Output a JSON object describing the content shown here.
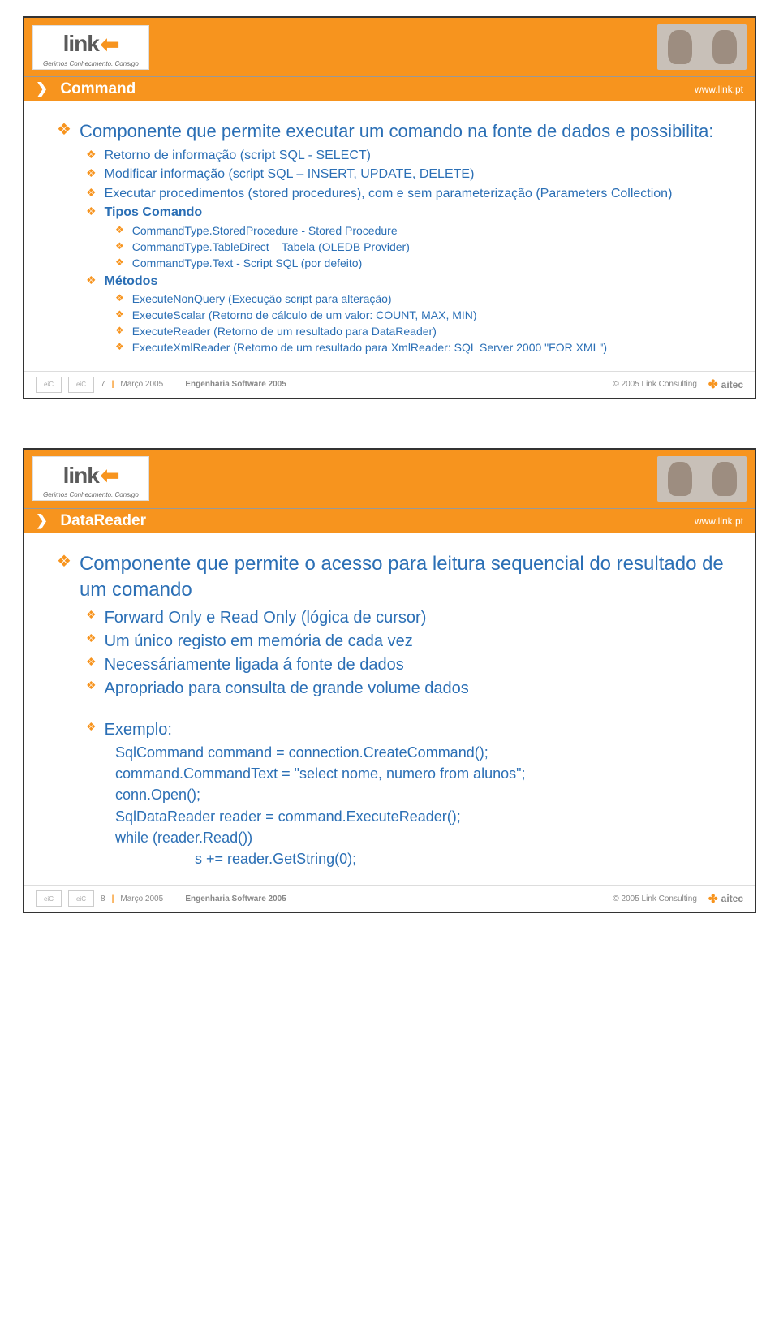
{
  "brand": {
    "logo_text": "link",
    "tagline": "Gerimos Conhecimento. Consigo"
  },
  "footer": {
    "date": "Março 2005",
    "course": "Engenharia Software 2005",
    "copyright": "© 2005 Link Consulting",
    "badge": "eiC",
    "partner": "aitec"
  },
  "slide1": {
    "page": "7",
    "title": "Command",
    "url": "www.link.pt",
    "h1": "Componente que permite executar um comando na fonte de dados e possibilita:",
    "items1": [
      "Retorno de informação (script SQL - SELECT)",
      "Modificar informação (script SQL – INSERT, UPDATE, DELETE)",
      "Executar procedimentos (stored procedures), com e sem parameterização (Parameters Collection)"
    ],
    "h2": "Tipos Comando",
    "items2": [
      "CommandType.StoredProcedure - Stored Procedure",
      "CommandType.TableDirect – Tabela (OLEDB Provider)",
      "CommandType.Text - Script SQL (por defeito)"
    ],
    "h3": "Métodos",
    "items3": [
      "ExecuteNonQuery (Execução script para alteração)",
      "ExecuteScalar (Retorno de cálculo de um valor: COUNT, MAX, MIN)",
      "ExecuteReader (Retorno de um resultado para DataReader)",
      "ExecuteXmlReader (Retorno de um resultado para XmlReader: SQL Server 2000 \"FOR XML\")"
    ]
  },
  "slide2": {
    "page": "8",
    "title": "DataReader",
    "url": "www.link.pt",
    "h1": "Componente que permite o acesso para leitura sequencial do resultado de um comando",
    "items1": [
      "Forward Only e Read Only (lógica de cursor)",
      "Um único registo em memória de cada vez",
      "Necessáriamente ligada á fonte de dados",
      "Apropriado para consulta de grande volume dados"
    ],
    "example_label": "Exemplo:",
    "code": [
      "SqlCommand command = connection.CreateCommand();",
      "command.CommandText = \"select nome, numero from alunos\";",
      "conn.Open();",
      "SqlDataReader reader = command.ExecuteReader();",
      "while (reader.Read())",
      "s += reader.GetString(0);"
    ]
  }
}
